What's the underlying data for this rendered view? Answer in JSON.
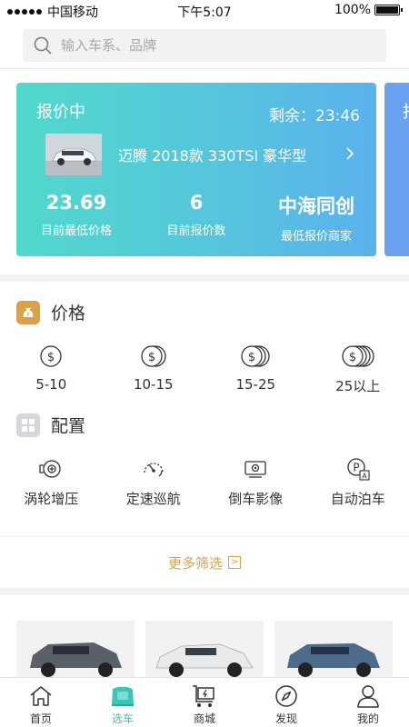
{
  "status_bar": {
    "carrier": "中国移动",
    "time": "下午5:07",
    "battery": "100%"
  },
  "search": {
    "placeholder": "输入车系、品牌"
  },
  "bid_card": {
    "title": "报价中",
    "remaining": "剩余：23:46",
    "car_name": "迈腾 2018款 330TSI 豪华型",
    "stats": [
      {
        "value": "23.69",
        "label": "目前最低价格"
      },
      {
        "value": "6",
        "label": "目前报价数"
      },
      {
        "value": "中海同创",
        "label": "最低报价商家"
      }
    ],
    "next_card_title": "报"
  },
  "price_section": {
    "title": "价格",
    "items": [
      {
        "label": "5-10"
      },
      {
        "label": "10-15"
      },
      {
        "label": "15-25"
      },
      {
        "label": "25以上"
      }
    ]
  },
  "config_section": {
    "title": "配置",
    "items": [
      {
        "label": "涡轮增压"
      },
      {
        "label": "定速巡航"
      },
      {
        "label": "倒车影像"
      },
      {
        "label": "自动泊车"
      }
    ]
  },
  "more_filter": {
    "label": "更多筛选",
    "arrow": ">"
  },
  "tabbar": {
    "items": [
      {
        "label": "首页"
      },
      {
        "label": "选车"
      },
      {
        "label": "商城"
      },
      {
        "label": "发现"
      },
      {
        "label": "我的"
      }
    ]
  },
  "colors": {
    "accent": "#3cc4b6",
    "gold": "#d8a24a",
    "card_start": "#52d8cc",
    "card_end": "#5ab1ec"
  }
}
